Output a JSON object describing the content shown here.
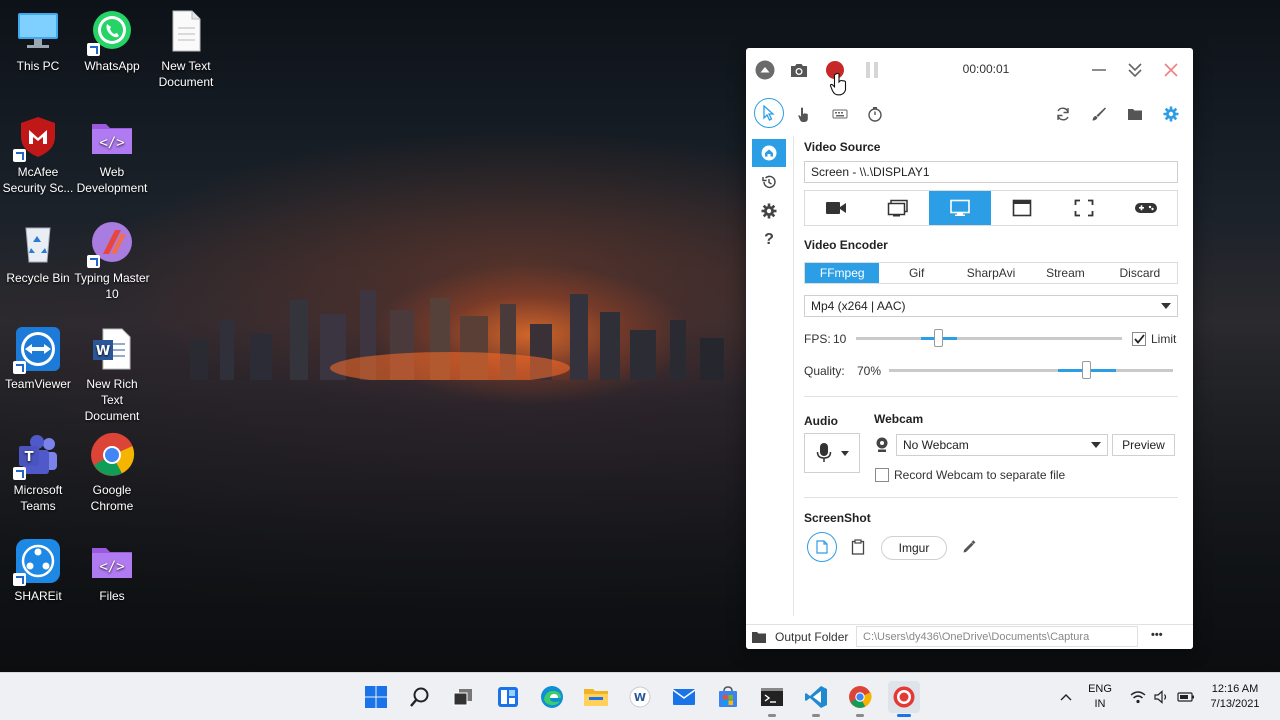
{
  "desktop": {
    "icons": [
      {
        "label": "This PC"
      },
      {
        "label": "WhatsApp"
      },
      {
        "label": "New Text Document"
      },
      {
        "label": "McAfee Security Sc..."
      },
      {
        "label": "Web Development"
      },
      {
        "label": "Recycle Bin"
      },
      {
        "label": "Typing Master 10"
      },
      {
        "label": "TeamViewer"
      },
      {
        "label": "New Rich Text Document"
      },
      {
        "label": "Microsoft Teams"
      },
      {
        "label": "Google Chrome"
      },
      {
        "label": "SHAREit"
      },
      {
        "label": "Files"
      }
    ]
  },
  "app": {
    "timer": "00:00:01",
    "video_source": {
      "title": "Video Source",
      "value": "Screen  -  \\\\.\\DISPLAY1",
      "source_types": [
        "webcam-icon",
        "region-icon",
        "screen-icon",
        "window-icon",
        "fullscreen-icon",
        "game-icon"
      ],
      "active_index": 2
    },
    "video_encoder": {
      "title": "Video Encoder",
      "tabs": [
        "FFmpeg",
        "Gif",
        "SharpAvi",
        "Stream",
        "Discard"
      ],
      "active_tab": 0,
      "codec": "Mp4 (x264 | AAC)"
    },
    "fps": {
      "label": "FPS:",
      "value": "10",
      "limit_label": "Limit",
      "limit_checked": true
    },
    "quality": {
      "label": "Quality:",
      "value": "70%"
    },
    "audio": {
      "title": "Audio"
    },
    "webcam": {
      "title": "Webcam",
      "value": "No Webcam",
      "preview_label": "Preview",
      "separate_label": "Record Webcam to separate file",
      "separate_checked": false
    },
    "screenshot": {
      "title": "ScreenShot",
      "imgur_label": "Imgur"
    },
    "output": {
      "label": "Output Folder",
      "path": "C:\\Users\\dy436\\OneDrive\\Documents\\Captura",
      "more": "•••"
    }
  },
  "taskbar": {
    "lang_top": "ENG",
    "lang_bottom": "IN",
    "time": "12:16 AM",
    "date": "7/13/2021"
  },
  "colors": {
    "accent": "#2c9ee6",
    "record": "#c62828",
    "close": "#f08080"
  }
}
